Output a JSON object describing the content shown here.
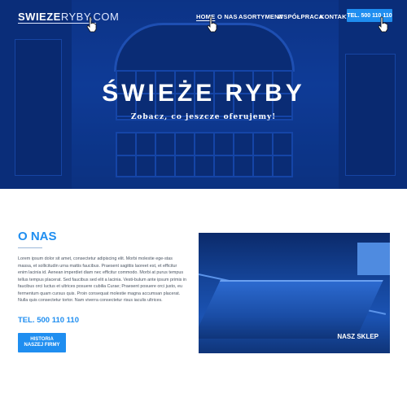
{
  "header": {
    "logo": {
      "bold": "SWIEZE",
      "thin": "RYBY.COM"
    },
    "nav": [
      {
        "label": "HOME",
        "active": true
      },
      {
        "label": "O NAS"
      },
      {
        "label": "ASORTYMENT"
      },
      {
        "label": "WSPÓŁPRACA"
      },
      {
        "label": "KONTAKT"
      }
    ],
    "tel_button": "TEL. 500 110 110"
  },
  "hero": {
    "title": "ŚWIEŻE RYBY",
    "subtitle": "Zobacz, co jeszcze oferujemy!"
  },
  "about": {
    "title": "O NAS",
    "text": "Lorem ipsum dolor sit amet, consectetur adipiscing elit. Morbi molestie ege-stas massa, et sollicitudin urna mattis faucibus. Praesent sagittis laoreet est, et efficitur enim lacinia id. Aenean imperdiet diam nec efficitur commodo. Morbi at purus tempus tellus tempus placerat. Sed faucibus sed elit a lacinia. Vesti-bulum ante ipsum primis in faucibus orci luctus et ultrices posuere cubilia Curae; Praesent posuere orci justo, eu fermentum quam cursus quis. Proin consequat molestie magna accumsan placerat. Nulla quis consectetur tortor. Nam viverra consectetur risus iaculis ultrices.",
    "tel": "TEL. 500 110 110",
    "history_button": {
      "line1": "HISTORIA",
      "line2": "NASZEJ FIRMY"
    }
  },
  "shop": {
    "caption": "NASZ SKLEP"
  },
  "icons": {
    "cursor": "hand-pointer-icon"
  },
  "colors": {
    "accent": "#1f8ef0",
    "hero_blue": "#123b8d"
  }
}
